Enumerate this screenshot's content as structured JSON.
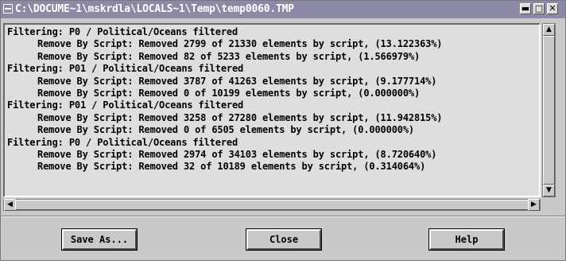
{
  "window": {
    "title": "C:\\DOCUME~1\\mskrdla\\LOCALS~1\\Temp\\temp0060.TMP",
    "controls": {
      "minimize": "▬",
      "maximize": "□",
      "close": "✕"
    }
  },
  "log_lines": [
    {
      "text": "Filtering: P0 / Political/Oceans filtered",
      "indent": false
    },
    {
      "text": "Remove By Script: Removed 2799 of 21330 elements by script, (13.122363%)",
      "indent": true
    },
    {
      "text": "Remove By Script: Removed 82 of 5233 elements by script, (1.566979%)",
      "indent": true
    },
    {
      "text": "Filtering: P01 / Political/Oceans filtered",
      "indent": false
    },
    {
      "text": "Remove By Script: Removed 3787 of 41263 elements by script, (9.177714%)",
      "indent": true
    },
    {
      "text": "Remove By Script: Removed 0 of 10199 elements by script, (0.000000%)",
      "indent": true
    },
    {
      "text": "Filtering: P01 / Political/Oceans filtered",
      "indent": false
    },
    {
      "text": "Remove By Script: Removed 3258 of 27280 elements by script, (11.942815%)",
      "indent": true
    },
    {
      "text": "Remove By Script: Removed 0 of 6505 elements by script, (0.000000%)",
      "indent": true
    },
    {
      "text": "Filtering: P0 / Political/Oceans filtered",
      "indent": false
    },
    {
      "text": "Remove By Script: Removed 2974 of 34103 elements by script, (8.720640%)",
      "indent": true
    },
    {
      "text": "Remove By Script: Removed 32 of 10189 elements by script, (0.314064%)",
      "indent": true
    }
  ],
  "scroll": {
    "up": "▲",
    "down": "▼",
    "left": "◀",
    "right": "▶"
  },
  "buttons": {
    "save_as": "Save As...",
    "close": "Close",
    "help": "Help"
  }
}
